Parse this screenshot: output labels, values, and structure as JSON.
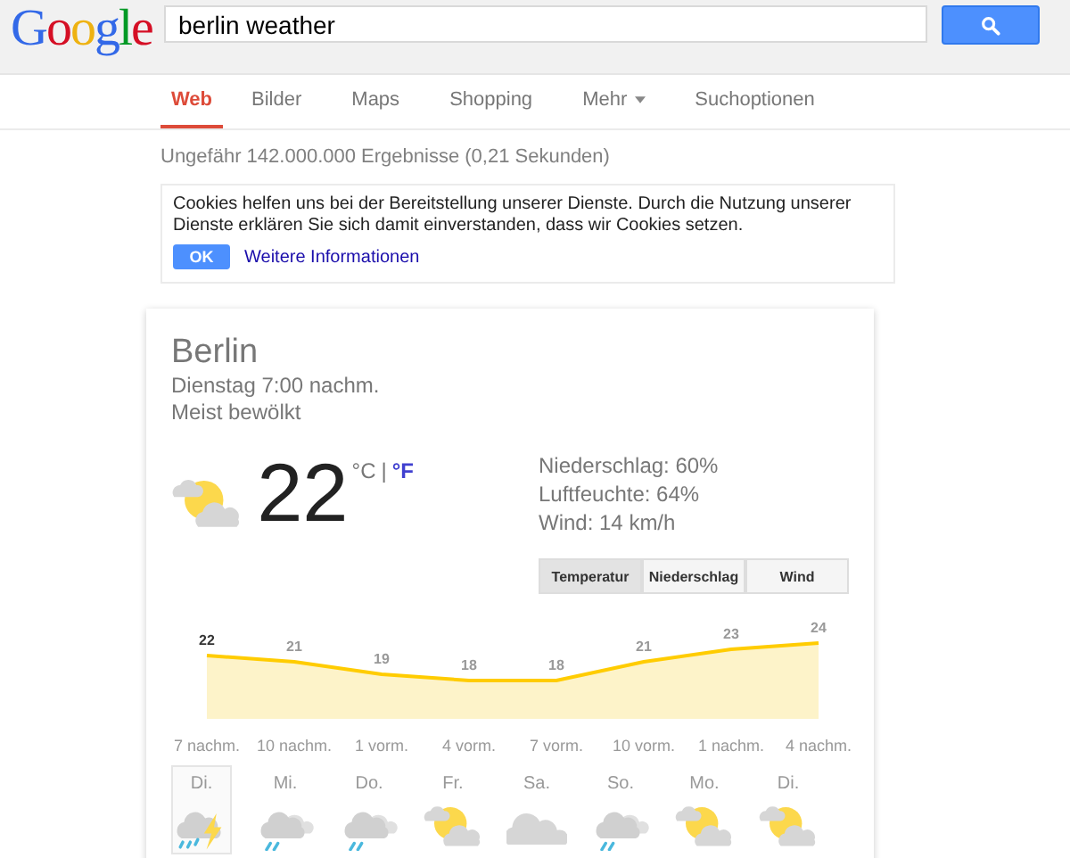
{
  "logo": "Google",
  "search": {
    "value": "berlin weather"
  },
  "tabs": [
    {
      "label": "Web",
      "selected": true,
      "menu": false
    },
    {
      "label": "Bilder",
      "selected": false,
      "menu": false
    },
    {
      "label": "Maps",
      "selected": false,
      "menu": false
    },
    {
      "label": "Shopping",
      "selected": false,
      "menu": false
    },
    {
      "label": "Mehr",
      "selected": false,
      "menu": true
    },
    {
      "label": "Suchoptionen",
      "selected": false,
      "menu": false
    }
  ],
  "result_stats": "Ungefähr 142.000.000 Ergebnisse (0,21 Sekunden)",
  "cookie_notice": {
    "text": "Cookies helfen uns bei der Bereitstellung unserer Dienste. Durch die Nutzung unserer Dienste erklären Sie sich damit einverstanden, dass wir Cookies setzen.",
    "ok": "OK",
    "link": "Weitere Informationen"
  },
  "weather": {
    "location": "Berlin",
    "time": "Dienstag 7:00 nachm.",
    "condition": "Meist bewölkt",
    "temperature": "22",
    "unit_c": "°C",
    "separator": "|",
    "unit_f": "°F",
    "details": [
      "Niederschlag: 60%",
      "Luftfeuchte: 64%",
      "Wind: 14 km/h"
    ],
    "chart_tabs": [
      {
        "label": "Temperatur",
        "selected": true
      },
      {
        "label": "Niederschlag",
        "selected": false
      },
      {
        "label": "Wind",
        "selected": false
      }
    ],
    "chart_data": {
      "type": "area",
      "categories": [
        "7 nachm.",
        "10 nachm.",
        "1 vorm.",
        "4 vorm.",
        "7 vorm.",
        "10 vorm.",
        "1 nachm.",
        "4 nachm."
      ],
      "series": [
        {
          "color": "#ffcc00",
          "values": [
            22,
            21,
            19,
            18,
            18,
            21,
            23,
            24
          ]
        }
      ],
      "data_labels": true
    },
    "days": [
      {
        "label": "Di.",
        "kind": "thunder-rain",
        "selected": true
      },
      {
        "label": "Mi.",
        "kind": "cloud-rain",
        "selected": false
      },
      {
        "label": "Do.",
        "kind": "cloud-rain",
        "selected": false
      },
      {
        "label": "Fr.",
        "kind": "sun-cloud",
        "selected": false
      },
      {
        "label": "Sa.",
        "kind": "cloud",
        "selected": false
      },
      {
        "label": "So.",
        "kind": "cloud-rain",
        "selected": false
      },
      {
        "label": "Mo.",
        "kind": "sun-cloud",
        "selected": false
      },
      {
        "label": "Di.",
        "kind": "sun-cloud",
        "selected": false
      }
    ]
  }
}
